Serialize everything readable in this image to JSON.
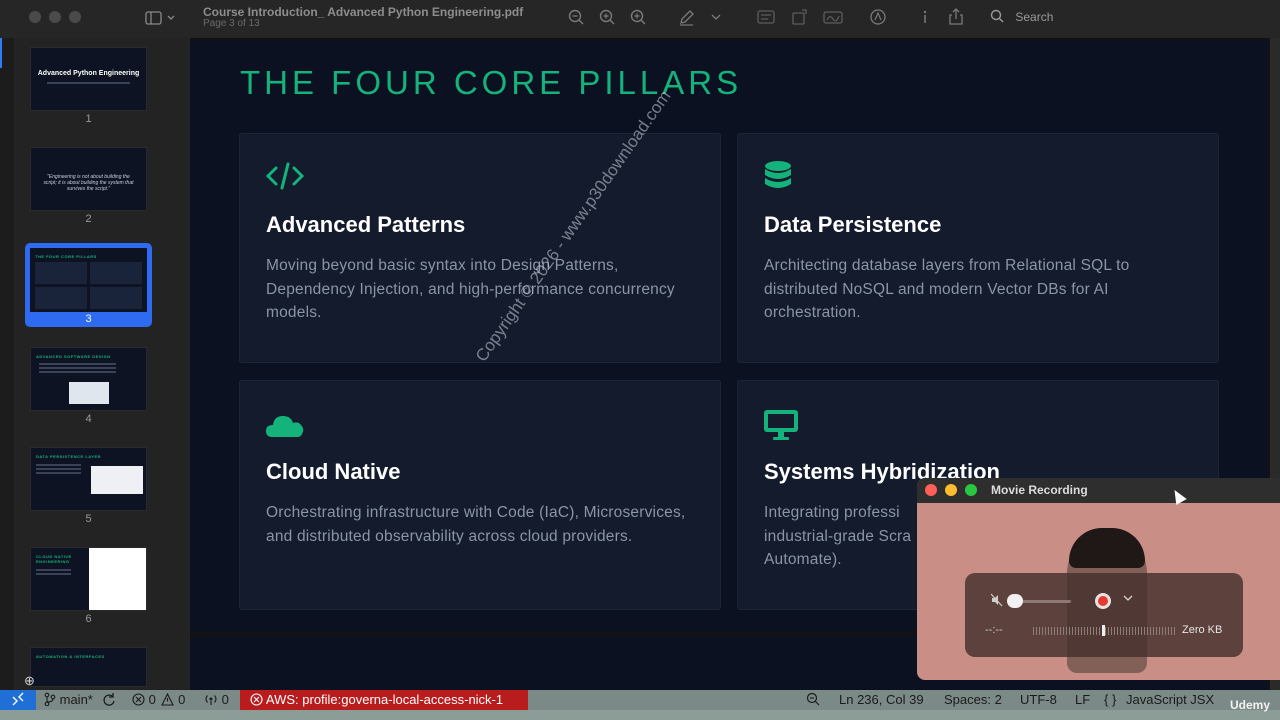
{
  "window": {
    "title": "Course Introduction_ Advanced Python Engineering.pdf",
    "page_indicator": "Page 3 of 13",
    "search_label": "Search"
  },
  "sidebar": {
    "thumbnails": [
      {
        "number": "1",
        "title": "Advanced Python Engineering"
      },
      {
        "number": "2",
        "quote": "\"Engineering is not about building the script; it is about building the system that survives the script.\""
      },
      {
        "number": "3",
        "heading": "THE FOUR CORE PILLARS",
        "selected": true
      },
      {
        "number": "4",
        "heading": "ADVANCED SOFTWARE DESIGN"
      },
      {
        "number": "5",
        "heading": "DATA PERSISTENCE LAYER"
      },
      {
        "number": "6",
        "heading": "CLOUD NATIVE ENGINEERING"
      },
      {
        "heading": "AUTOMATION & INTERFACES"
      }
    ]
  },
  "slide": {
    "title": "THE FOUR CORE PILLARS",
    "cards": [
      {
        "icon": "code-icon",
        "title": "Advanced Patterns",
        "body": "Moving beyond basic syntax into Design Patterns, Dependency Injection, and high-performance concurrency models."
      },
      {
        "icon": "database-icon",
        "title": "Data Persistence",
        "body": "Architecting database layers from Relational SQL to distributed NoSQL and modern Vector DBs for AI orchestration."
      },
      {
        "icon": "cloud-icon",
        "title": "Cloud Native",
        "body": "Orchestrating infrastructure with Code (IaC), Microservices, and distributed observability across cloud providers."
      },
      {
        "icon": "monitor-icon",
        "title": "Systems Hybridization",
        "body": "Integrating professi industrial-grade Scra Automate)."
      }
    ],
    "accent_color": "#14b37b"
  },
  "watermark": "Copyright © 2026 - www.p30download.com",
  "movie_recording": {
    "title": "Movie Recording",
    "time": "--:--",
    "size": "Zero KB"
  },
  "statusbar": {
    "branch": "main*",
    "errors": "0",
    "warnings": "0",
    "ports": "0",
    "aws": "AWS: profile:governa-local-access-nick-1",
    "position": "Ln 236, Col 39",
    "spaces": "Spaces: 2",
    "encoding": "UTF-8",
    "eol": "LF",
    "language": "JavaScript JSX",
    "braces": "{ }"
  },
  "udemy_logo": "Udemy"
}
